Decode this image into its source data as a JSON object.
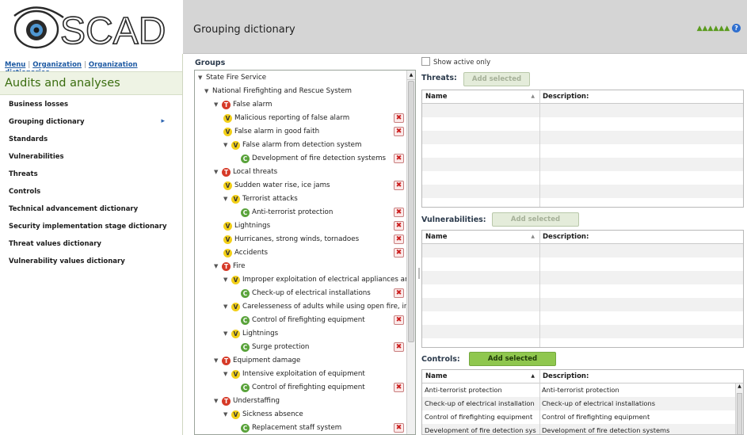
{
  "logo": {
    "text": "SCAD"
  },
  "breadcrumbs": [
    "Menu",
    "Organization",
    "Organization dictionaries"
  ],
  "sidebar": {
    "title": "Audits and analyses",
    "items": [
      {
        "label": "Business losses"
      },
      {
        "label": "Grouping dictionary",
        "selected": true
      },
      {
        "label": "Standards"
      },
      {
        "label": "Vulnerabilities"
      },
      {
        "label": "Threats"
      },
      {
        "label": "Controls"
      },
      {
        "label": "Technical advancement dictionary"
      },
      {
        "label": "Security implementation stage dictionary"
      },
      {
        "label": "Threat values dictionary"
      },
      {
        "label": "Vulnerability values dictionary"
      }
    ]
  },
  "header": {
    "title": "Grouping dictionary",
    "help": "?"
  },
  "groups": {
    "title": "Groups",
    "badges": {
      "threat": "T",
      "vulnerability": "V",
      "control": "C"
    },
    "tree": [
      {
        "text": "State Fire Service",
        "level": 0,
        "type": "group",
        "expanded": true,
        "del": false
      },
      {
        "text": "National Firefighting and Rescue System",
        "level": 1,
        "type": "group",
        "expanded": true,
        "del": false
      },
      {
        "text": "False alarm",
        "level": 2,
        "type": "threat",
        "expanded": true,
        "del": false
      },
      {
        "text": "Malicious reporting of false alarm",
        "level": 3,
        "type": "vulnerability",
        "del": true
      },
      {
        "text": "False alarm in good faith",
        "level": 3,
        "type": "vulnerability",
        "del": true
      },
      {
        "text": "False alarm from detection system",
        "level": 3,
        "type": "vulnerability",
        "expanded": true,
        "del": false
      },
      {
        "text": "Development of fire detection systems",
        "level": 4,
        "type": "control",
        "del": true
      },
      {
        "text": "Local threats",
        "level": 2,
        "type": "threat",
        "expanded": true,
        "del": false
      },
      {
        "text": "Sudden water rise, ice jams",
        "level": 3,
        "type": "vulnerability",
        "del": true
      },
      {
        "text": "Terrorist attacks",
        "level": 3,
        "type": "vulnerability",
        "expanded": true,
        "del": false
      },
      {
        "text": "Anti-terrorist protection",
        "level": 4,
        "type": "control",
        "del": true
      },
      {
        "text": "Lightnings",
        "level": 3,
        "type": "vulnerability",
        "del": true
      },
      {
        "text": "Hurricanes, strong winds, tornadoes",
        "level": 3,
        "type": "vulnerability",
        "del": true
      },
      {
        "text": "Accidents",
        "level": 3,
        "type": "vulnerability",
        "del": true
      },
      {
        "text": "Fire",
        "level": 2,
        "type": "threat",
        "expanded": true,
        "del": false
      },
      {
        "text": "Improper exploitation of electrical appliances and",
        "level": 3,
        "type": "vulnerability",
        "expanded": true,
        "del": false
      },
      {
        "text": "Check-up of electrical installations",
        "level": 4,
        "type": "control",
        "del": true
      },
      {
        "text": "Carelesseness of adults while using open fire, inc",
        "level": 3,
        "type": "vulnerability",
        "expanded": true,
        "del": false
      },
      {
        "text": "Control of firefighting equipment",
        "level": 4,
        "type": "control",
        "del": true
      },
      {
        "text": "Lightnings",
        "level": 3,
        "type": "vulnerability",
        "expanded": true,
        "del": false
      },
      {
        "text": "Surge protection",
        "level": 4,
        "type": "control",
        "del": true
      },
      {
        "text": "Equipment damage",
        "level": 2,
        "type": "threat",
        "expanded": true,
        "del": false
      },
      {
        "text": "Intensive exploitation of equipment",
        "level": 3,
        "type": "vulnerability",
        "expanded": true,
        "del": false
      },
      {
        "text": "Control of firefighting equipment",
        "level": 4,
        "type": "control",
        "del": true
      },
      {
        "text": "Understaffing",
        "level": 2,
        "type": "threat",
        "expanded": true,
        "del": false
      },
      {
        "text": "Sickness absence",
        "level": 3,
        "type": "vulnerability",
        "expanded": true,
        "del": false
      },
      {
        "text": "Replacement staff system",
        "level": 4,
        "type": "control",
        "del": true
      }
    ]
  },
  "show_active_only": {
    "label": "Show active only",
    "checked": false
  },
  "threats": {
    "title": "Threats:",
    "add_label": "Add selected",
    "columns": {
      "name": "Name",
      "description": "Description:"
    }
  },
  "vulnerabilities": {
    "title": "Vulnerabilities:",
    "add_label": "Add selected",
    "columns": {
      "name": "Name",
      "description": "Description:"
    }
  },
  "controls": {
    "title": "Controls:",
    "add_label": "Add selected",
    "columns": {
      "name": "Name",
      "description": "Description:"
    },
    "rows": [
      {
        "name": "Anti-terrorist protection",
        "description": "Anti-terrorist protection"
      },
      {
        "name": "Check-up of electrical installation",
        "description": "Check-up of electrical installations"
      },
      {
        "name": "Control of firefighting equipment",
        "description": "Control of firefighting equipment"
      },
      {
        "name": "Development of fire detection sys",
        "description": "Development of fire detection systems"
      }
    ]
  },
  "colors": {
    "accent_green": "#8fc74e",
    "threat": "#d63a28",
    "vulnerability": "#f2cf18",
    "control": "#5aa33b"
  }
}
